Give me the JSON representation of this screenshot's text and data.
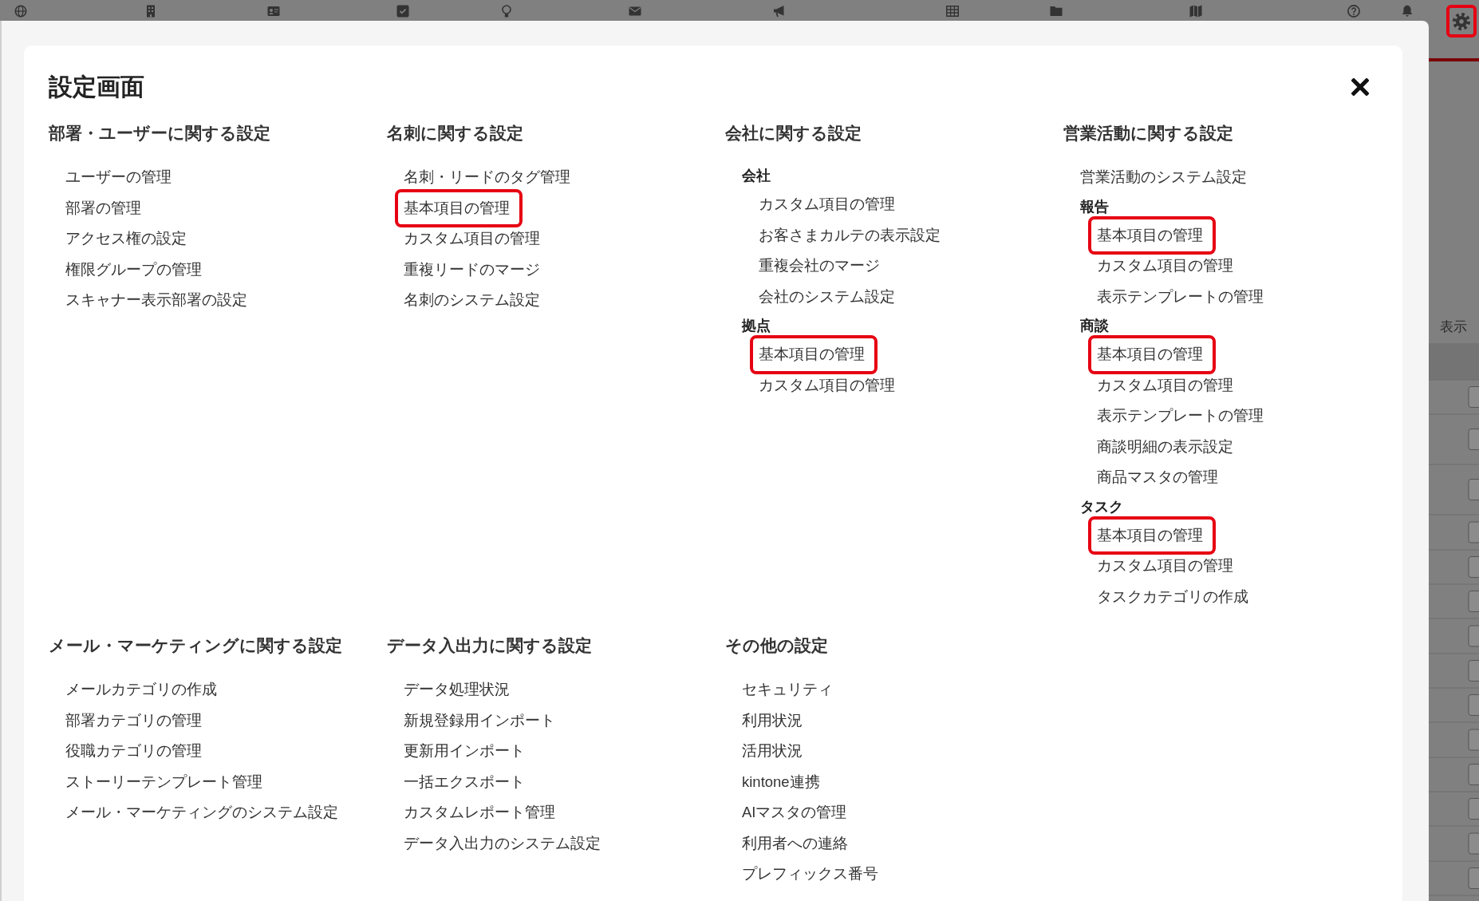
{
  "header": {
    "settings_button": {
      "highlighted": true
    }
  },
  "page_behind": {
    "label": "表示"
  },
  "dialog": {
    "title": "設定画面",
    "rows": [
      {
        "sections": [
          {
            "heading": "部署・ユーザーに関する設定",
            "items": [
              {
                "kind": "link",
                "label": "ユーザーの管理",
                "highlighted": false
              },
              {
                "kind": "link",
                "label": "部署の管理",
                "highlighted": false
              },
              {
                "kind": "link",
                "label": "アクセス権の設定",
                "highlighted": false
              },
              {
                "kind": "link",
                "label": "権限グループの管理",
                "highlighted": false
              },
              {
                "kind": "link",
                "label": "スキャナー表示部署の設定",
                "highlighted": false
              }
            ]
          },
          {
            "heading": "名刺に関する設定",
            "items": [
              {
                "kind": "link",
                "label": "名刺・リードのタグ管理",
                "highlighted": false
              },
              {
                "kind": "link",
                "label": "基本項目の管理",
                "highlighted": true
              },
              {
                "kind": "link",
                "label": "カスタム項目の管理",
                "highlighted": false
              },
              {
                "kind": "link",
                "label": "重複リードのマージ",
                "highlighted": false
              },
              {
                "kind": "link",
                "label": "名刺のシステム設定",
                "highlighted": false
              }
            ]
          },
          {
            "heading": "会社に関する設定",
            "items": [
              {
                "kind": "group",
                "label": "会社",
                "children": [
                  {
                    "kind": "link",
                    "label": "カスタム項目の管理",
                    "highlighted": false
                  },
                  {
                    "kind": "link",
                    "label": "お客さまカルテの表示設定",
                    "highlighted": false
                  },
                  {
                    "kind": "link",
                    "label": "重複会社のマージ",
                    "highlighted": false
                  },
                  {
                    "kind": "link",
                    "label": "会社のシステム設定",
                    "highlighted": false
                  }
                ]
              },
              {
                "kind": "group",
                "label": "拠点",
                "children": [
                  {
                    "kind": "link",
                    "label": "基本項目の管理",
                    "highlighted": true
                  },
                  {
                    "kind": "link",
                    "label": "カスタム項目の管理",
                    "highlighted": false
                  }
                ]
              }
            ]
          },
          {
            "heading": "営業活動に関する設定",
            "items": [
              {
                "kind": "link",
                "label": "営業活動のシステム設定",
                "highlighted": false
              },
              {
                "kind": "group",
                "label": "報告",
                "children": [
                  {
                    "kind": "link",
                    "label": "基本項目の管理",
                    "highlighted": true
                  },
                  {
                    "kind": "link",
                    "label": "カスタム項目の管理",
                    "highlighted": false
                  },
                  {
                    "kind": "link",
                    "label": "表示テンプレートの管理",
                    "highlighted": false
                  }
                ]
              },
              {
                "kind": "group",
                "label": "商談",
                "children": [
                  {
                    "kind": "link",
                    "label": "基本項目の管理",
                    "highlighted": true
                  },
                  {
                    "kind": "link",
                    "label": "カスタム項目の管理",
                    "highlighted": false
                  },
                  {
                    "kind": "link",
                    "label": "表示テンプレートの管理",
                    "highlighted": false
                  },
                  {
                    "kind": "link",
                    "label": "商談明細の表示設定",
                    "highlighted": false
                  },
                  {
                    "kind": "link",
                    "label": "商品マスタの管理",
                    "highlighted": false
                  }
                ]
              },
              {
                "kind": "group",
                "label": "タスク",
                "children": [
                  {
                    "kind": "link",
                    "label": "基本項目の管理",
                    "highlighted": true
                  },
                  {
                    "kind": "link",
                    "label": "カスタム項目の管理",
                    "highlighted": false
                  },
                  {
                    "kind": "link",
                    "label": "タスクカテゴリの作成",
                    "highlighted": false
                  }
                ]
              }
            ]
          }
        ]
      },
      {
        "sections": [
          {
            "heading": "メール・マーケティングに関する設定",
            "items": [
              {
                "kind": "link",
                "label": "メールカテゴリの作成",
                "highlighted": false
              },
              {
                "kind": "link",
                "label": "部署カテゴリの管理",
                "highlighted": false
              },
              {
                "kind": "link",
                "label": "役職カテゴリの管理",
                "highlighted": false
              },
              {
                "kind": "link",
                "label": "ストーリーテンプレート管理",
                "highlighted": false
              },
              {
                "kind": "link",
                "label": "メール・マーケティングのシステム設定",
                "highlighted": false
              }
            ]
          },
          {
            "heading": "データ入出力に関する設定",
            "items": [
              {
                "kind": "link",
                "label": "データ処理状況",
                "highlighted": false
              },
              {
                "kind": "link",
                "label": "新規登録用インポート",
                "highlighted": false
              },
              {
                "kind": "link",
                "label": "更新用インポート",
                "highlighted": false
              },
              {
                "kind": "link",
                "label": "一括エクスポート",
                "highlighted": false
              },
              {
                "kind": "link",
                "label": "カスタムレポート管理",
                "highlighted": false
              },
              {
                "kind": "link",
                "label": "データ入出力のシステム設定",
                "highlighted": false
              }
            ]
          },
          {
            "heading": "その他の設定",
            "items": [
              {
                "kind": "link",
                "label": "セキュリティ",
                "highlighted": false
              },
              {
                "kind": "link",
                "label": "利用状況",
                "highlighted": false
              },
              {
                "kind": "link",
                "label": "活用状況",
                "highlighted": false
              },
              {
                "kind": "link",
                "label": "kintone連携",
                "highlighted": false
              },
              {
                "kind": "link",
                "label": "AIマスタの管理",
                "highlighted": false
              },
              {
                "kind": "link",
                "label": "利用者への連絡",
                "highlighted": false
              },
              {
                "kind": "link",
                "label": "プレフィックス番号",
                "highlighted": false
              }
            ]
          }
        ]
      }
    ]
  }
}
